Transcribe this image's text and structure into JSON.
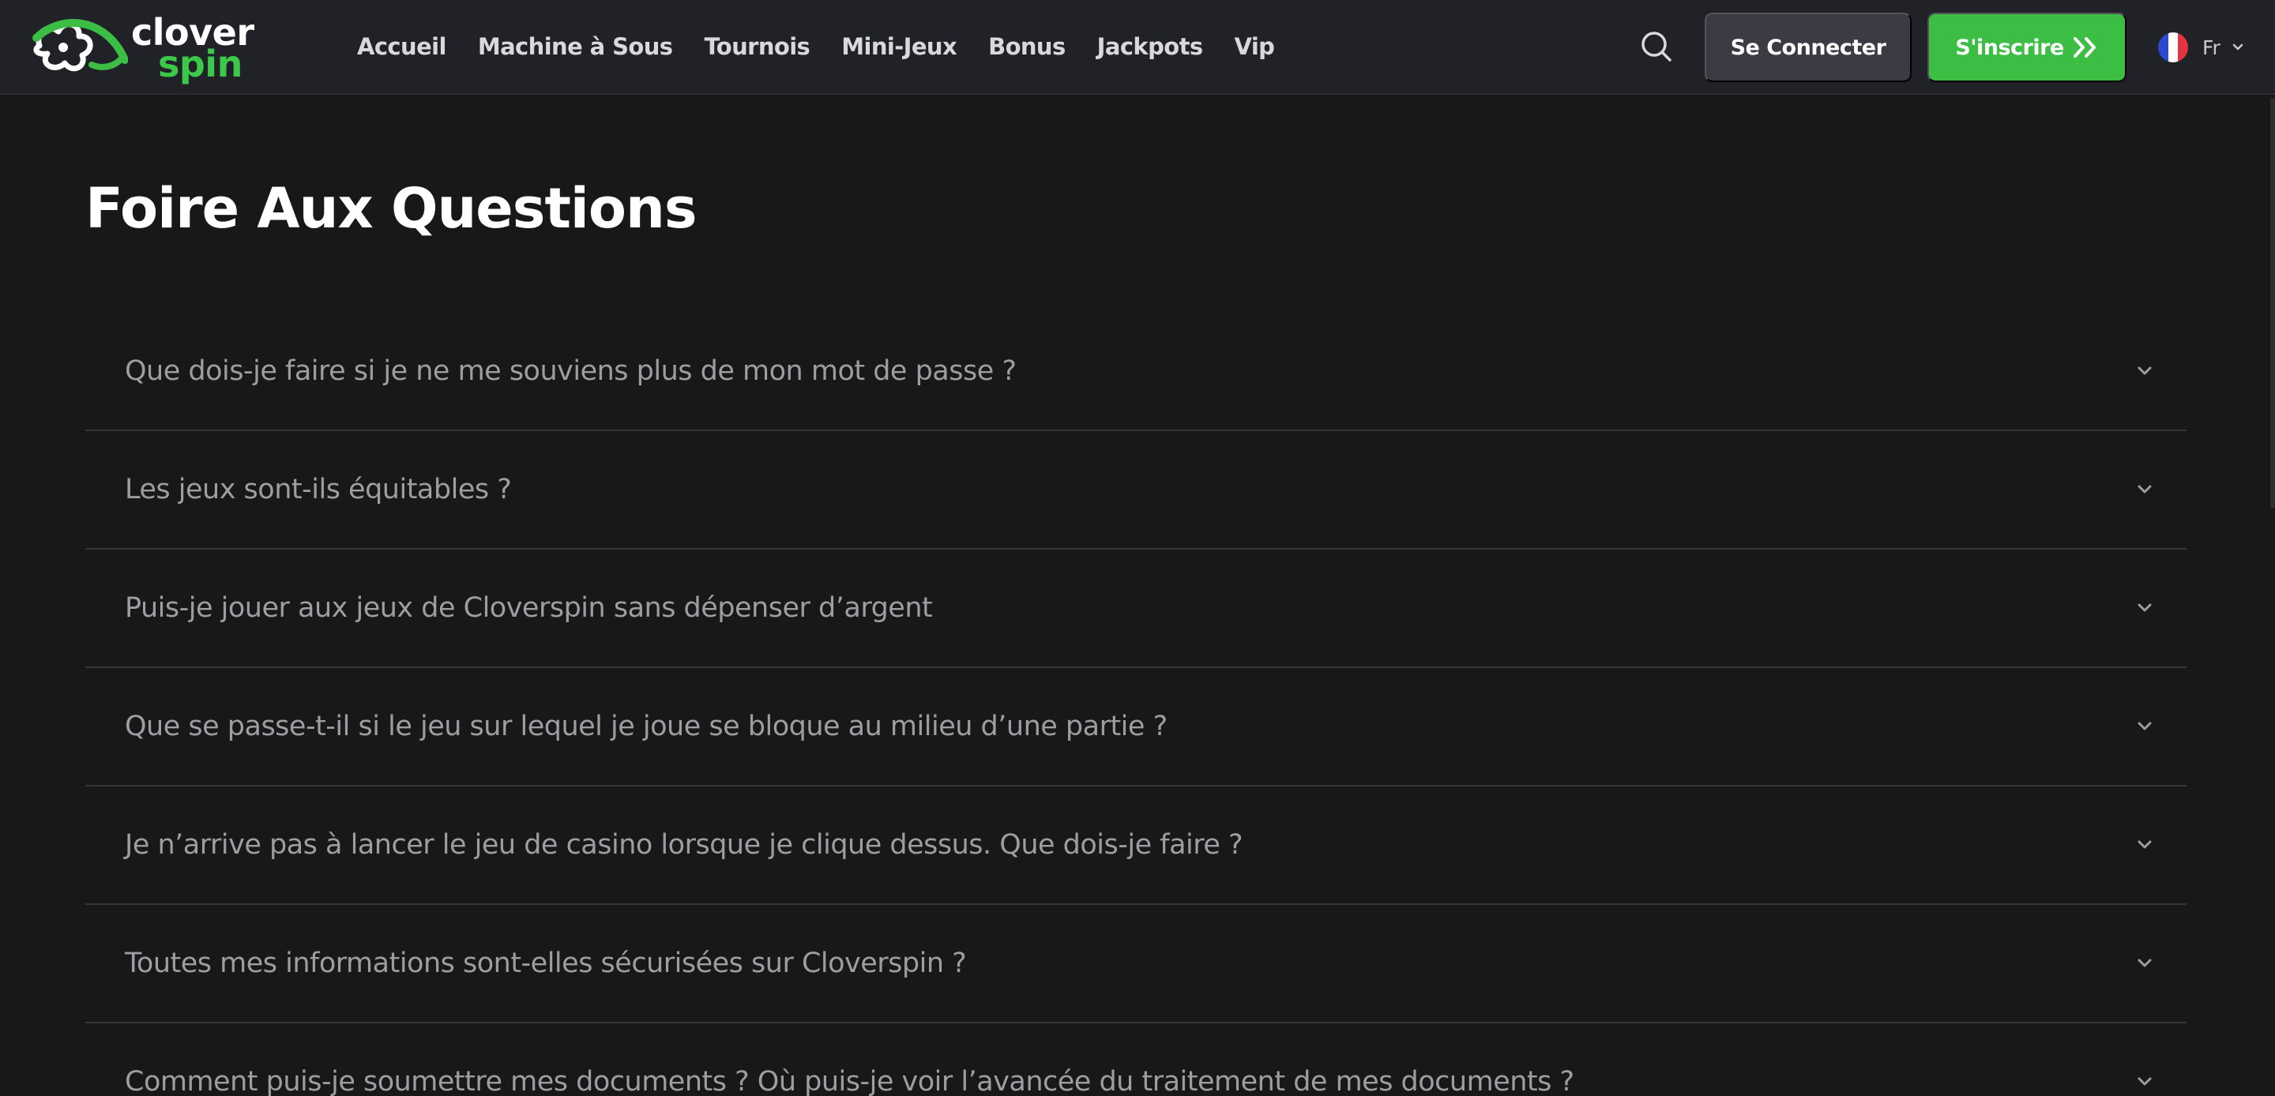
{
  "brand": {
    "name_top": "clover",
    "name_bottom": "spin",
    "accent_color": "#3cbd44",
    "logo_icon": "clover-swirl-icon"
  },
  "header": {
    "nav": [
      {
        "label": "Accueil"
      },
      {
        "label": "Machine à Sous"
      },
      {
        "label": "Tournois"
      },
      {
        "label": "Mini-Jeux"
      },
      {
        "label": "Bonus"
      },
      {
        "label": "Jackpots"
      },
      {
        "label": "Vip"
      }
    ],
    "search_icon": "search-icon",
    "login_label": "Se Connecter",
    "signup_label": "S'inscrire",
    "signup_icon": "double-chevron-right-icon",
    "language": {
      "code": "Fr",
      "flag_icon": "france-flag-icon",
      "chevron_icon": "chevron-down-icon"
    }
  },
  "main": {
    "title": "Foire Aux Questions",
    "faq_chevron_icon": "chevron-down-icon",
    "faq": [
      {
        "question": "Que dois-je faire si je ne me souviens plus de mon mot de passe ?"
      },
      {
        "question": "Les jeux sont-ils équitables ?"
      },
      {
        "question": "Puis-je jouer aux jeux de Cloverspin sans dépenser d’argent"
      },
      {
        "question": "Que se passe-t-il si le jeu sur lequel je joue se bloque au milieu d’une partie ?"
      },
      {
        "question": "Je n’arrive pas à lancer le jeu de casino lorsque je clique dessus. Que dois-je faire ?"
      },
      {
        "question": "Toutes mes informations sont-elles sécurisées sur Cloverspin ?"
      },
      {
        "question": "Comment puis-je soumettre mes documents ? Où puis-je voir l’avancée du traitement de mes documents ?"
      }
    ]
  },
  "colors": {
    "background": "#181818",
    "header_bg": "#212227",
    "login_bg": "#3b3c43",
    "question_text": "#9d9ea2",
    "divider": "#34353a"
  }
}
